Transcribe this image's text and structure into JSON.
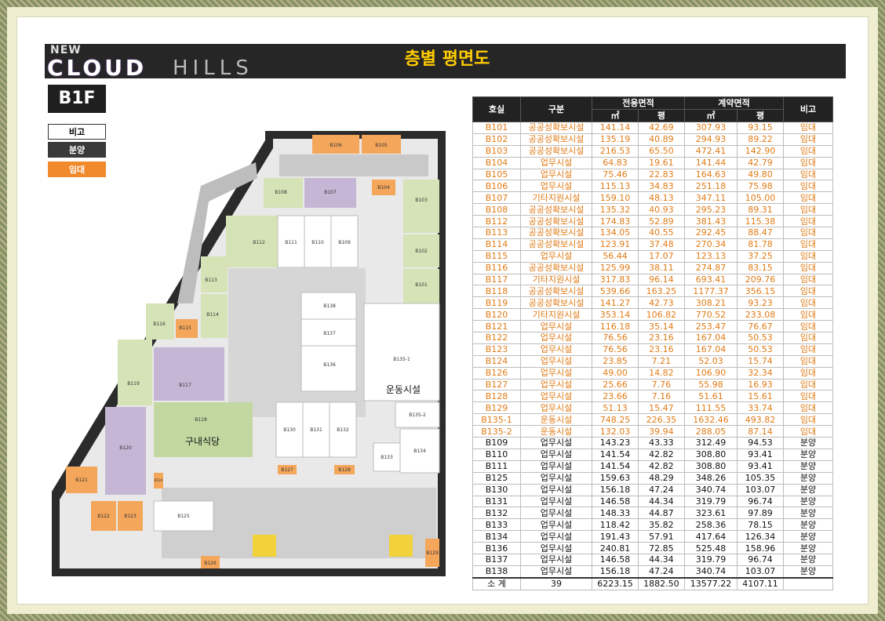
{
  "header": {
    "logo_top": "NEW",
    "logo_main": "CLOUD",
    "logo_sub": "HILLS",
    "title": "층별 평면도"
  },
  "floor_badge": "B1F",
  "legend": [
    {
      "label": "비고",
      "color": "#ffffff"
    },
    {
      "label": "분양",
      "color": "#3a3a3a"
    },
    {
      "label": "임대",
      "color": "#f08a2a"
    }
  ],
  "plan": {
    "rooms": [
      "B106",
      "B105",
      "B108",
      "B107",
      "B104",
      "B103",
      "B112",
      "B111",
      "B110",
      "B109",
      "B102",
      "B113",
      "B101",
      "B114",
      "B115",
      "B116",
      "B138",
      "B137",
      "B136",
      "B135-1",
      "B117",
      "B119",
      "B118",
      "B130",
      "B131",
      "B132",
      "B135-2",
      "B120",
      "B133",
      "B134",
      "B121",
      "B127",
      "B128",
      "B122",
      "B123",
      "B125",
      "B126",
      "B129",
      "B124"
    ],
    "labels": {
      "fitness": "운동시설",
      "cafeteria": "구내식당"
    }
  },
  "table": {
    "headers": {
      "unit": "호실",
      "type": "구분",
      "exclusive": "전용면적",
      "contract": "계약면적",
      "note": "비고",
      "sqm": "㎡",
      "pyeong": "평"
    },
    "rows": [
      {
        "unit": "B101",
        "type": "공공성확보시설",
        "ex_sqm": "141.14",
        "ex_py": "42.69",
        "ct_sqm": "307.93",
        "ct_py": "93.15",
        "note": "임대",
        "kind": "lease"
      },
      {
        "unit": "B102",
        "type": "공공성확보시설",
        "ex_sqm": "135.19",
        "ex_py": "40.89",
        "ct_sqm": "294.93",
        "ct_py": "89.22",
        "note": "임대",
        "kind": "lease"
      },
      {
        "unit": "B103",
        "type": "공공성확보시설",
        "ex_sqm": "216.53",
        "ex_py": "65.50",
        "ct_sqm": "472.41",
        "ct_py": "142.90",
        "note": "임대",
        "kind": "lease"
      },
      {
        "unit": "B104",
        "type": "업무시설",
        "ex_sqm": "64.83",
        "ex_py": "19.61",
        "ct_sqm": "141.44",
        "ct_py": "42.79",
        "note": "임대",
        "kind": "lease"
      },
      {
        "unit": "B105",
        "type": "업무시설",
        "ex_sqm": "75.46",
        "ex_py": "22.83",
        "ct_sqm": "164.63",
        "ct_py": "49.80",
        "note": "임대",
        "kind": "lease"
      },
      {
        "unit": "B106",
        "type": "업무시설",
        "ex_sqm": "115.13",
        "ex_py": "34.83",
        "ct_sqm": "251.18",
        "ct_py": "75.98",
        "note": "임대",
        "kind": "lease"
      },
      {
        "unit": "B107",
        "type": "기타지원시설",
        "ex_sqm": "159.10",
        "ex_py": "48.13",
        "ct_sqm": "347.11",
        "ct_py": "105.00",
        "note": "임대",
        "kind": "lease"
      },
      {
        "unit": "B108",
        "type": "공공성확보시설",
        "ex_sqm": "135.32",
        "ex_py": "40.93",
        "ct_sqm": "295.23",
        "ct_py": "89.31",
        "note": "임대",
        "kind": "lease"
      },
      {
        "unit": "B112",
        "type": "공공성확보시설",
        "ex_sqm": "174.83",
        "ex_py": "52.89",
        "ct_sqm": "381.43",
        "ct_py": "115.38",
        "note": "임대",
        "kind": "lease"
      },
      {
        "unit": "B113",
        "type": "공공성확보시설",
        "ex_sqm": "134.05",
        "ex_py": "40.55",
        "ct_sqm": "292.45",
        "ct_py": "88.47",
        "note": "임대",
        "kind": "lease"
      },
      {
        "unit": "B114",
        "type": "공공성확보시설",
        "ex_sqm": "123.91",
        "ex_py": "37.48",
        "ct_sqm": "270.34",
        "ct_py": "81.78",
        "note": "임대",
        "kind": "lease"
      },
      {
        "unit": "B115",
        "type": "업무시설",
        "ex_sqm": "56.44",
        "ex_py": "17.07",
        "ct_sqm": "123.13",
        "ct_py": "37.25",
        "note": "임대",
        "kind": "lease"
      },
      {
        "unit": "B116",
        "type": "공공성확보시설",
        "ex_sqm": "125.99",
        "ex_py": "38.11",
        "ct_sqm": "274.87",
        "ct_py": "83.15",
        "note": "임대",
        "kind": "lease"
      },
      {
        "unit": "B117",
        "type": "기타지원시설",
        "ex_sqm": "317.83",
        "ex_py": "96.14",
        "ct_sqm": "693.41",
        "ct_py": "209.76",
        "note": "임대",
        "kind": "lease"
      },
      {
        "unit": "B118",
        "type": "공공성확보시설",
        "ex_sqm": "539.66",
        "ex_py": "163.25",
        "ct_sqm": "1177.37",
        "ct_py": "356.15",
        "note": "임대",
        "kind": "lease"
      },
      {
        "unit": "B119",
        "type": "공공성확보시설",
        "ex_sqm": "141.27",
        "ex_py": "42.73",
        "ct_sqm": "308.21",
        "ct_py": "93.23",
        "note": "임대",
        "kind": "lease"
      },
      {
        "unit": "B120",
        "type": "기타지원시설",
        "ex_sqm": "353.14",
        "ex_py": "106.82",
        "ct_sqm": "770.52",
        "ct_py": "233.08",
        "note": "임대",
        "kind": "lease"
      },
      {
        "unit": "B121",
        "type": "업무시설",
        "ex_sqm": "116.18",
        "ex_py": "35.14",
        "ct_sqm": "253.47",
        "ct_py": "76.67",
        "note": "임대",
        "kind": "lease"
      },
      {
        "unit": "B122",
        "type": "업무시설",
        "ex_sqm": "76.56",
        "ex_py": "23.16",
        "ct_sqm": "167.04",
        "ct_py": "50.53",
        "note": "임대",
        "kind": "lease"
      },
      {
        "unit": "B123",
        "type": "업무시설",
        "ex_sqm": "76.56",
        "ex_py": "23.16",
        "ct_sqm": "167.04",
        "ct_py": "50.53",
        "note": "임대",
        "kind": "lease"
      },
      {
        "unit": "B124",
        "type": "업무시설",
        "ex_sqm": "23.85",
        "ex_py": "7.21",
        "ct_sqm": "52.03",
        "ct_py": "15.74",
        "note": "임대",
        "kind": "lease"
      },
      {
        "unit": "B126",
        "type": "업무시설",
        "ex_sqm": "49.00",
        "ex_py": "14.82",
        "ct_sqm": "106.90",
        "ct_py": "32.34",
        "note": "임대",
        "kind": "lease"
      },
      {
        "unit": "B127",
        "type": "업무시설",
        "ex_sqm": "25.66",
        "ex_py": "7.76",
        "ct_sqm": "55.98",
        "ct_py": "16.93",
        "note": "임대",
        "kind": "lease"
      },
      {
        "unit": "B128",
        "type": "업무시설",
        "ex_sqm": "23.66",
        "ex_py": "7.16",
        "ct_sqm": "51.61",
        "ct_py": "15.61",
        "note": "임대",
        "kind": "lease"
      },
      {
        "unit": "B129",
        "type": "업무시설",
        "ex_sqm": "51.13",
        "ex_py": "15.47",
        "ct_sqm": "111.55",
        "ct_py": "33.74",
        "note": "임대",
        "kind": "lease"
      },
      {
        "unit": "B135-1",
        "type": "운동시설",
        "ex_sqm": "748.25",
        "ex_py": "226.35",
        "ct_sqm": "1632.46",
        "ct_py": "493.82",
        "note": "임대",
        "kind": "lease"
      },
      {
        "unit": "B135-2",
        "type": "운동시설",
        "ex_sqm": "132.03",
        "ex_py": "39.94",
        "ct_sqm": "288.05",
        "ct_py": "87.14",
        "note": "임대",
        "kind": "lease"
      },
      {
        "unit": "B109",
        "type": "업무시설",
        "ex_sqm": "143.23",
        "ex_py": "43.33",
        "ct_sqm": "312.49",
        "ct_py": "94.53",
        "note": "분양",
        "kind": "sale"
      },
      {
        "unit": "B110",
        "type": "업무시설",
        "ex_sqm": "141.54",
        "ex_py": "42.82",
        "ct_sqm": "308.80",
        "ct_py": "93.41",
        "note": "분양",
        "kind": "sale"
      },
      {
        "unit": "B111",
        "type": "업무시설",
        "ex_sqm": "141.54",
        "ex_py": "42.82",
        "ct_sqm": "308.80",
        "ct_py": "93.41",
        "note": "분양",
        "kind": "sale"
      },
      {
        "unit": "B125",
        "type": "업무시설",
        "ex_sqm": "159.63",
        "ex_py": "48.29",
        "ct_sqm": "348.26",
        "ct_py": "105.35",
        "note": "분양",
        "kind": "sale"
      },
      {
        "unit": "B130",
        "type": "업무시설",
        "ex_sqm": "156.18",
        "ex_py": "47.24",
        "ct_sqm": "340.74",
        "ct_py": "103.07",
        "note": "분양",
        "kind": "sale"
      },
      {
        "unit": "B131",
        "type": "업무시설",
        "ex_sqm": "146.58",
        "ex_py": "44.34",
        "ct_sqm": "319.79",
        "ct_py": "96.74",
        "note": "분양",
        "kind": "sale"
      },
      {
        "unit": "B132",
        "type": "업무시설",
        "ex_sqm": "148.33",
        "ex_py": "44.87",
        "ct_sqm": "323.61",
        "ct_py": "97.89",
        "note": "분양",
        "kind": "sale"
      },
      {
        "unit": "B133",
        "type": "업무시설",
        "ex_sqm": "118.42",
        "ex_py": "35.82",
        "ct_sqm": "258.36",
        "ct_py": "78.15",
        "note": "분양",
        "kind": "sale"
      },
      {
        "unit": "B134",
        "type": "업무시설",
        "ex_sqm": "191.43",
        "ex_py": "57.91",
        "ct_sqm": "417.64",
        "ct_py": "126.34",
        "note": "분양",
        "kind": "sale"
      },
      {
        "unit": "B136",
        "type": "업무시설",
        "ex_sqm": "240.81",
        "ex_py": "72.85",
        "ct_sqm": "525.48",
        "ct_py": "158.96",
        "note": "분양",
        "kind": "sale"
      },
      {
        "unit": "B137",
        "type": "업무시설",
        "ex_sqm": "146.58",
        "ex_py": "44.34",
        "ct_sqm": "319.79",
        "ct_py": "96.74",
        "note": "분양",
        "kind": "sale"
      },
      {
        "unit": "B138",
        "type": "업무시설",
        "ex_sqm": "156.18",
        "ex_py": "47.24",
        "ct_sqm": "340.74",
        "ct_py": "103.07",
        "note": "분양",
        "kind": "sale"
      }
    ],
    "total": {
      "unit": "소 계",
      "type": "39",
      "ex_sqm": "6223.15",
      "ex_py": "1882.50",
      "ct_sqm": "13577.22",
      "ct_py": "4107.11",
      "note": ""
    }
  }
}
